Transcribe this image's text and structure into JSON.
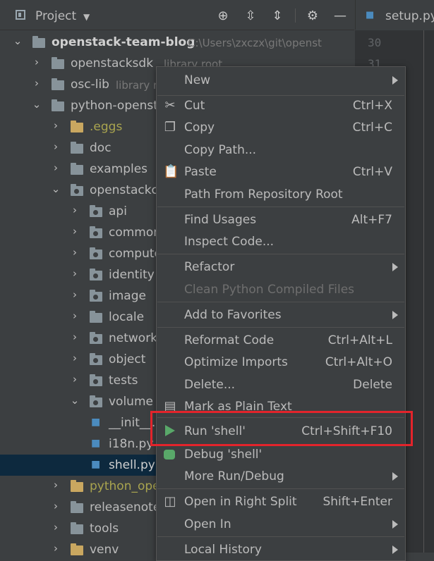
{
  "header": {
    "title": "Project",
    "buttons": [
      "locate-icon",
      "expand-all-icon",
      "collapse-all-icon",
      "gear-icon",
      "hide-icon"
    ]
  },
  "editor": {
    "tab_label": "setup.py",
    "line_numbers": [
      "30",
      "31"
    ]
  },
  "tree": {
    "root_name": "openstack-team-blog",
    "root_path": "C:\\Users\\zxczx\\git\\openst",
    "items": [
      {
        "name": "openstacksdk",
        "note": "library root"
      },
      {
        "name": "osc-lib",
        "note": "library r"
      },
      {
        "name": "python-opensta"
      },
      {
        "name": ".eggs"
      },
      {
        "name": "doc"
      },
      {
        "name": "examples"
      },
      {
        "name": "openstackcl"
      },
      {
        "name": "api"
      },
      {
        "name": "common"
      },
      {
        "name": "compute"
      },
      {
        "name": "identity"
      },
      {
        "name": "image"
      },
      {
        "name": "locale"
      },
      {
        "name": "network"
      },
      {
        "name": "object"
      },
      {
        "name": "tests"
      },
      {
        "name": "volume"
      },
      {
        "name": "__init__.p"
      },
      {
        "name": "i18n.py"
      },
      {
        "name": "shell.py"
      },
      {
        "name": "python_ope"
      },
      {
        "name": "releasenote"
      },
      {
        "name": "tools"
      },
      {
        "name": "venv"
      }
    ]
  },
  "context_menu": {
    "items": [
      {
        "label": "New",
        "shortcut": "",
        "submenu": true
      },
      {
        "label": "Cut",
        "shortcut": "Ctrl+X",
        "icon": "cut-icon"
      },
      {
        "label": "Copy",
        "shortcut": "Ctrl+C",
        "icon": "copy-icon"
      },
      {
        "label": "Copy Path...",
        "shortcut": ""
      },
      {
        "label": "Paste",
        "shortcut": "Ctrl+V",
        "icon": "paste-icon"
      },
      {
        "label": "Path From Repository Root",
        "shortcut": ""
      },
      {
        "label": "Find Usages",
        "shortcut": "Alt+F7"
      },
      {
        "label": "Inspect Code...",
        "shortcut": ""
      },
      {
        "label": "Refactor",
        "shortcut": "",
        "submenu": true
      },
      {
        "label": "Clean Python Compiled Files",
        "shortcut": "",
        "disabled": true
      },
      {
        "label": "Add to Favorites",
        "shortcut": "",
        "submenu": true
      },
      {
        "label": "Reformat Code",
        "shortcut": "Ctrl+Alt+L"
      },
      {
        "label": "Optimize Imports",
        "shortcut": "Ctrl+Alt+O"
      },
      {
        "label": "Delete...",
        "shortcut": "Delete"
      },
      {
        "label": "Mark as Plain Text",
        "shortcut": ""
      },
      {
        "label": "Run 'shell'",
        "shortcut": "Ctrl+Shift+F10",
        "icon": "run-icon"
      },
      {
        "label": "Debug 'shell'",
        "shortcut": "",
        "icon": "debug-icon"
      },
      {
        "label": "More Run/Debug",
        "shortcut": "",
        "submenu": true
      },
      {
        "label": "Open in Right Split",
        "shortcut": "Shift+Enter",
        "icon": "split-icon"
      },
      {
        "label": "Open In",
        "shortcut": "",
        "submenu": true
      },
      {
        "label": "Local History",
        "shortcut": "",
        "submenu": true
      }
    ]
  },
  "colors": {
    "highlight": "#e3242b",
    "run_green": "#59a869",
    "selection": "#0d293e"
  }
}
